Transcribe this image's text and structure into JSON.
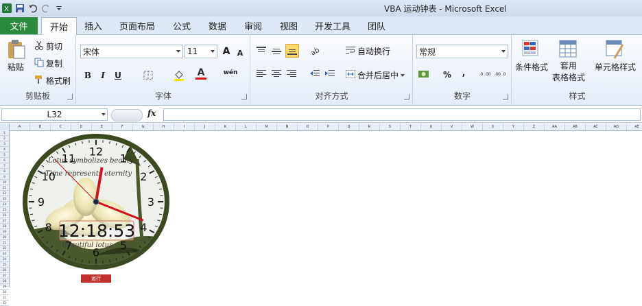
{
  "window": {
    "title": "VBA 运动钟表 - Microsoft Excel"
  },
  "tabs": {
    "file": "文件",
    "home": "开始",
    "insert": "插入",
    "layout": "页面布局",
    "formulas": "公式",
    "data": "数据",
    "review": "审阅",
    "view": "视图",
    "developer": "开发工具",
    "team": "团队"
  },
  "clipboard": {
    "paste": "粘贴",
    "cut": "剪切",
    "copy": "复制",
    "format_painter": "格式刷",
    "label": "剪贴板"
  },
  "font": {
    "name": "宋体",
    "size": "11",
    "bold": "B",
    "italic": "I",
    "underline": "U",
    "label": "字体",
    "grow": "A",
    "shrink": "A",
    "phonetic": "wén"
  },
  "alignment": {
    "wrap": "自动换行",
    "merge": "合并后居中",
    "label": "对齐方式"
  },
  "number": {
    "format": "常规",
    "percent": "%",
    "comma": ",",
    "label": "数字",
    "inc_decimal": ".0 .00",
    "dec_decimal": ".00 .0"
  },
  "styles": {
    "conditional": "条件格式",
    "table_line1": "套用",
    "table_line2": "表格格式",
    "cell": "单元格样式",
    "label": "样式"
  },
  "formula_bar": {
    "name_box": "L32",
    "fx": "fx",
    "formula": ""
  },
  "columns": [
    "A",
    "B",
    "C",
    "D",
    "E",
    "F",
    "G",
    "H",
    "I",
    "J",
    "K",
    "L",
    "M",
    "N",
    "O",
    "P",
    "Q",
    "R",
    "S",
    "T",
    "U",
    "V",
    "W",
    "X",
    "Y",
    "Z",
    "AA",
    "AB",
    "AC",
    "AD",
    "AE",
    "AF"
  ],
  "rows": [
    "1",
    "2",
    "3",
    "4",
    "5",
    "6",
    "7",
    "8",
    "9",
    "10",
    "11",
    "12",
    "13",
    "14",
    "15",
    "16",
    "17",
    "18",
    "19",
    "20",
    "21",
    "22",
    "23",
    "24",
    "25",
    "26",
    "27",
    "28",
    "29",
    "30",
    "31",
    "32"
  ],
  "clock": {
    "time": "12:18:53",
    "numerals": [
      "12",
      "1",
      "2",
      "3",
      "4",
      "5",
      "6",
      "7",
      "8",
      "9",
      "10",
      "11"
    ],
    "text_line1": "Lotus symbolizes beauty",
    "text_line2": "Time represents eternity",
    "text_line3": "Beautiful lotus",
    "hour": 12,
    "minute": 18,
    "second": 53
  },
  "run_button": "运行",
  "colors": {
    "file_tab": "#2a8b3c",
    "clock_rim": "#3c4a22",
    "hand": "#d0101a",
    "run_button": "#c0312d"
  }
}
